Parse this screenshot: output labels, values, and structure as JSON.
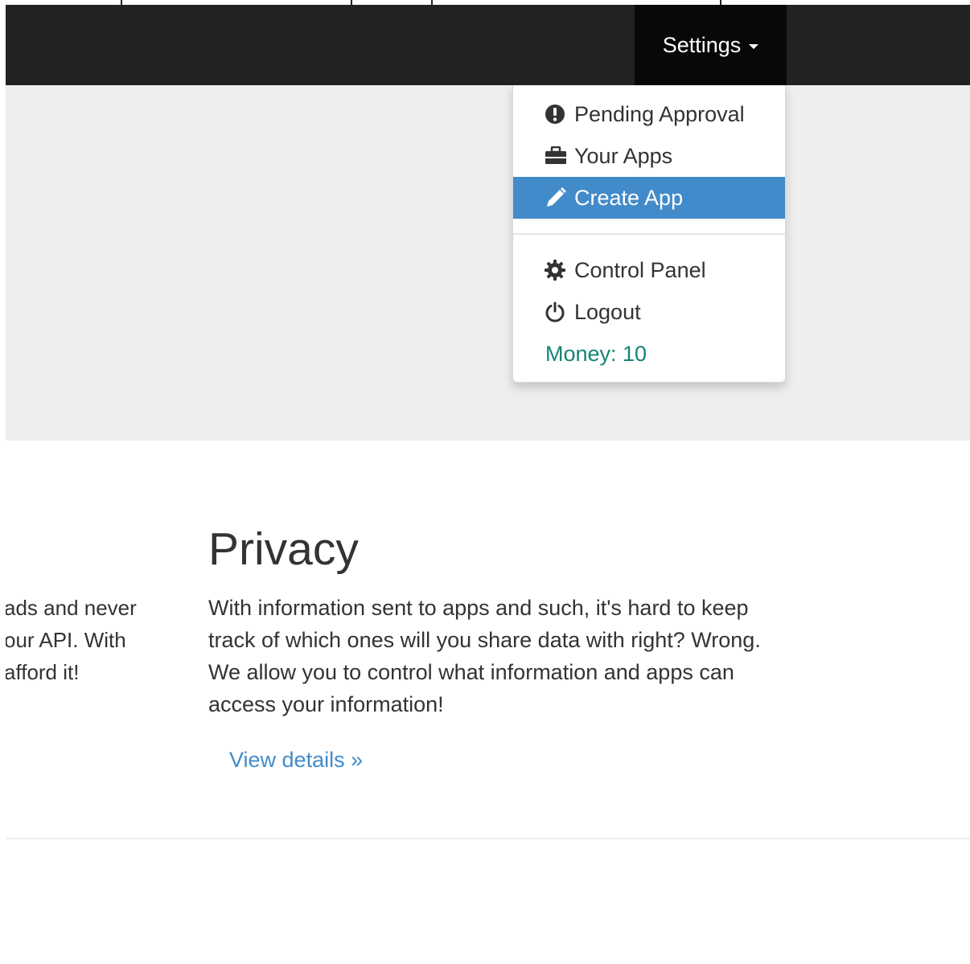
{
  "navbar": {
    "settings_label": "Settings",
    "dropdown": {
      "items": [
        {
          "label": "Pending Approval",
          "icon": "exclamation-circle-icon"
        },
        {
          "label": "Your Apps",
          "icon": "briefcase-icon"
        },
        {
          "label": "Create App",
          "icon": "pencil-icon",
          "active": true
        },
        {
          "label": "Control Panel",
          "icon": "gear-icon"
        },
        {
          "label": "Logout",
          "icon": "power-icon"
        }
      ],
      "money_text": "Money: 10"
    }
  },
  "left_column": {
    "text_lines": [
      "ads and never",
      "our API. With",
      "afford it!"
    ]
  },
  "privacy": {
    "title": "Privacy",
    "body_lines": [
      "With information sent to apps and such, it's hard to keep",
      "track of which ones will you share data with right? Wrong.",
      "We allow you to control what information and apps can",
      "access your information!"
    ],
    "link_label": "View details »"
  },
  "colors": {
    "navbar_bg": "#222222",
    "active_item_bg": "#428bca",
    "link": "#428bca",
    "money_text": "#138474",
    "jumbotron_bg": "#eeeeee"
  }
}
